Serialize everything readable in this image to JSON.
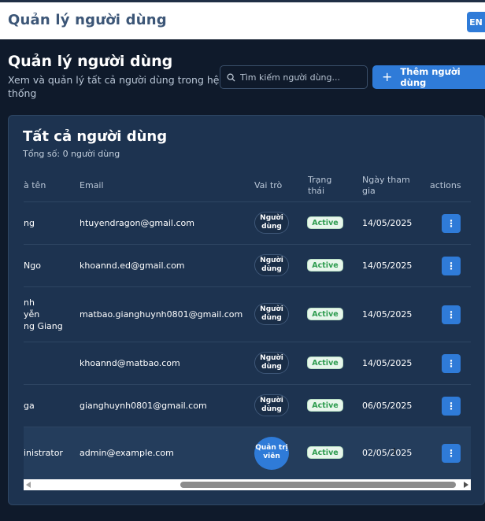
{
  "header": {
    "app_title": "Quản lý người dùng",
    "lang": "EN"
  },
  "page": {
    "title": "Quản lý người dùng",
    "subtitle": "Xem và quản lý tất cả người dùng trong hệ thống",
    "search_placeholder": "Tìm kiếm người dùng...",
    "add_button": "Thêm người dùng",
    "add_icon": "+"
  },
  "card": {
    "title": "Tất cả người dùng",
    "total": "Tổng số: 0 người dùng"
  },
  "table": {
    "columns": [
      "à tên",
      "Email",
      "Vai trò",
      "Trạng thái",
      "Ngày tham gia",
      "actions"
    ],
    "rows": [
      {
        "name": "ng",
        "email": "htuyendragon@gmail.com",
        "role": "Người dùng",
        "status": "Active",
        "date": "14/05/2025"
      },
      {
        "name": "Ngo",
        "email": "khoannd.ed@gmail.com",
        "role": "Người dùng",
        "status": "Active",
        "date": "14/05/2025"
      },
      {
        "name": "nh\nyễn\nng Giang",
        "email": "matbao.gianghuynh0801@gmail.com",
        "role": "Người dùng",
        "status": "Active",
        "date": "14/05/2025"
      },
      {
        "name": "",
        "email": "khoannd@matbao.com",
        "role": "Người dùng",
        "status": "Active",
        "date": "14/05/2025"
      },
      {
        "name": "ga",
        "email": "gianghuynh0801@gmail.com",
        "role": "Người dùng",
        "status": "Active",
        "date": "06/05/2025"
      },
      {
        "name": "inistrator",
        "email": "admin@example.com",
        "role": "Quản trị viên",
        "status": "Active",
        "date": "02/05/2025"
      }
    ],
    "action_icon": "⋮"
  },
  "colors": {
    "accent": "#2f7bd8",
    "background": "#0f1a2b",
    "card": "#1d3350",
    "active_text": "#2e9c4f"
  },
  "icons": {
    "search": "search-icon",
    "more": "more-vertical-icon"
  }
}
